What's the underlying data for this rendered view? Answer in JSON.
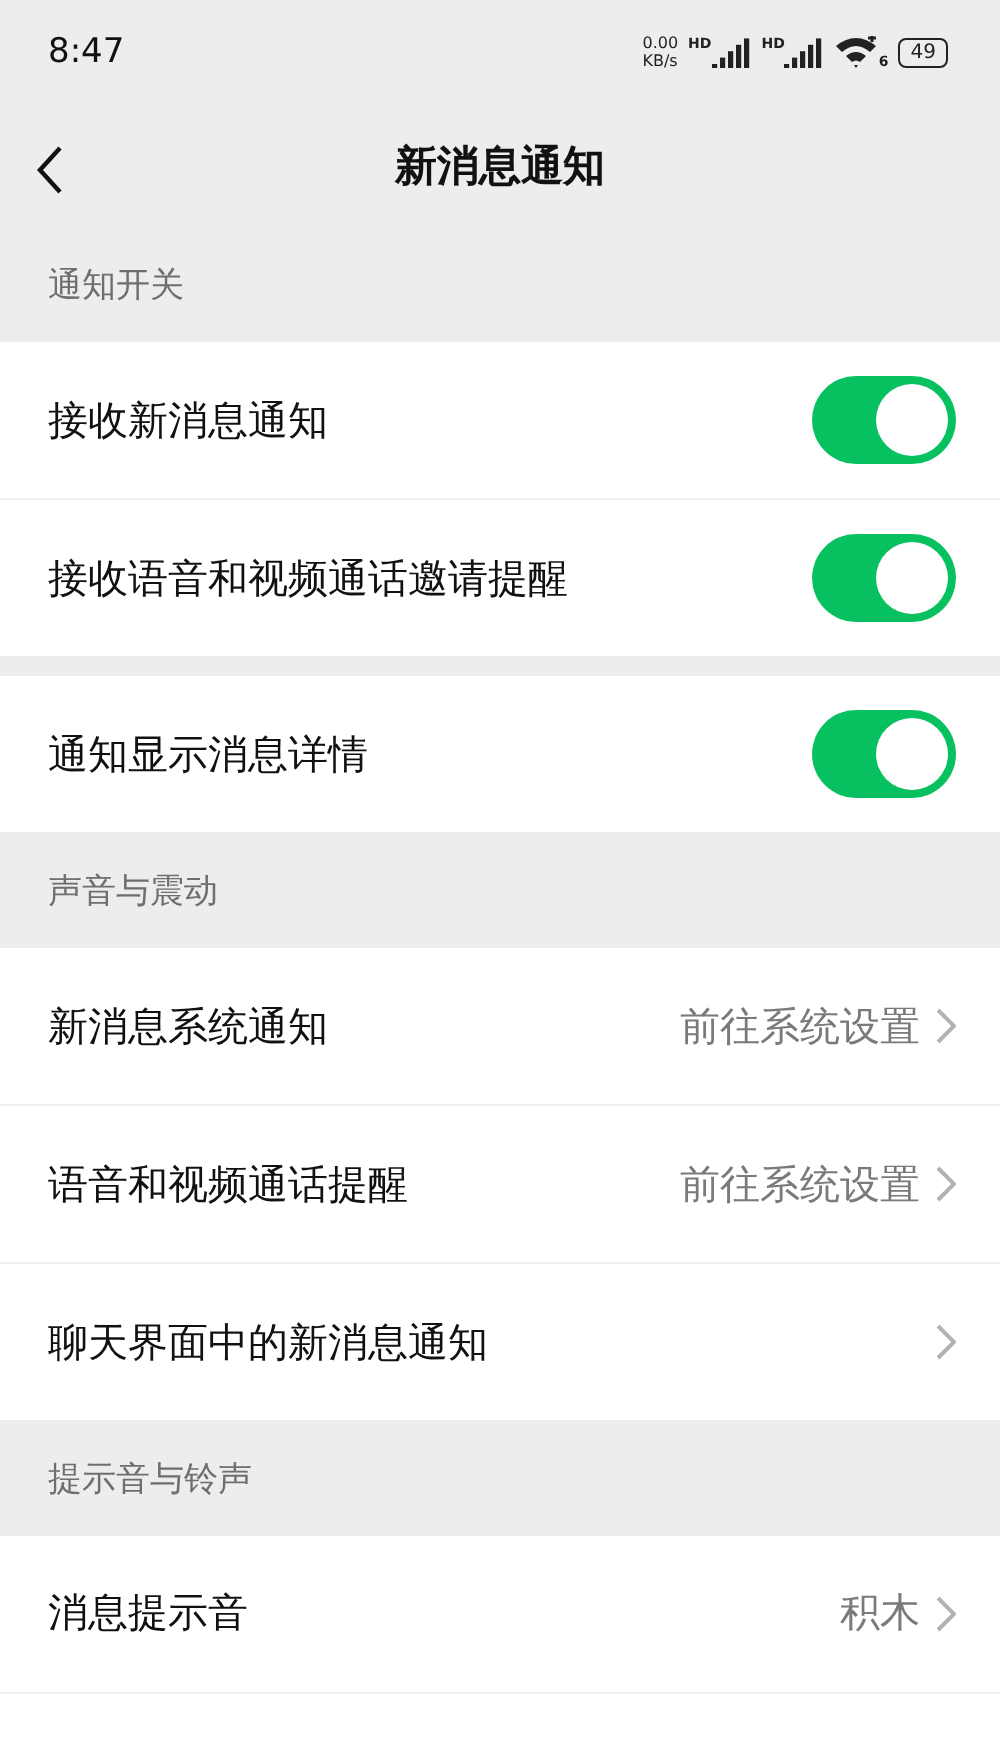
{
  "status_bar": {
    "time": "8:47",
    "net_speed": "0.00",
    "net_unit": "KB/s",
    "signal_tag_1": "HD",
    "signal_tag_2": "HD",
    "wifi_tag": "6",
    "battery": "49"
  },
  "header": {
    "title": "新消息通知"
  },
  "sections": [
    {
      "title": "通知开关",
      "groups": [
        [
          {
            "kind": "toggle",
            "label": "接收新消息通知",
            "on": true
          },
          {
            "kind": "toggle",
            "label": "接收语音和视频通话邀请提醒",
            "on": true
          }
        ],
        [
          {
            "kind": "toggle",
            "label": "通知显示消息详情",
            "on": true
          }
        ]
      ]
    },
    {
      "title": "声音与震动",
      "groups": [
        [
          {
            "kind": "link",
            "label": "新消息系统通知",
            "value": "前往系统设置"
          },
          {
            "kind": "link",
            "label": "语音和视频通话提醒",
            "value": "前往系统设置"
          },
          {
            "kind": "link",
            "label": "聊天界面中的新消息通知"
          }
        ]
      ]
    },
    {
      "title": "提示音与铃声",
      "groups": [
        [
          {
            "kind": "link",
            "label": "消息提示音",
            "value": "积木"
          },
          {
            "kind": "blank"
          }
        ]
      ]
    }
  ]
}
